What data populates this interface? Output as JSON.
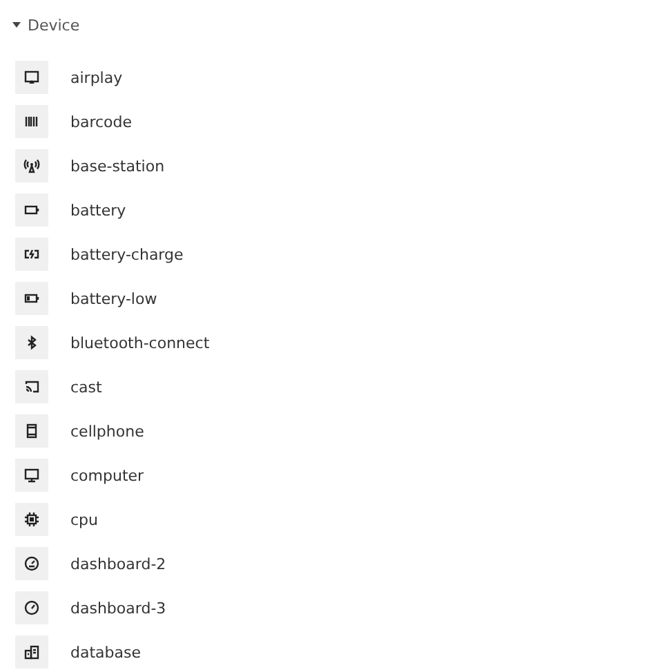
{
  "section": {
    "title": "Device",
    "expanded": true,
    "items": [
      {
        "label": "airplay"
      },
      {
        "label": "barcode"
      },
      {
        "label": "base-station"
      },
      {
        "label": "battery"
      },
      {
        "label": "battery-charge"
      },
      {
        "label": "battery-low"
      },
      {
        "label": "bluetooth-connect"
      },
      {
        "label": "cast"
      },
      {
        "label": "cellphone"
      },
      {
        "label": "computer"
      },
      {
        "label": "cpu"
      },
      {
        "label": "dashboard-2"
      },
      {
        "label": "dashboard-3"
      },
      {
        "label": "database"
      }
    ]
  }
}
